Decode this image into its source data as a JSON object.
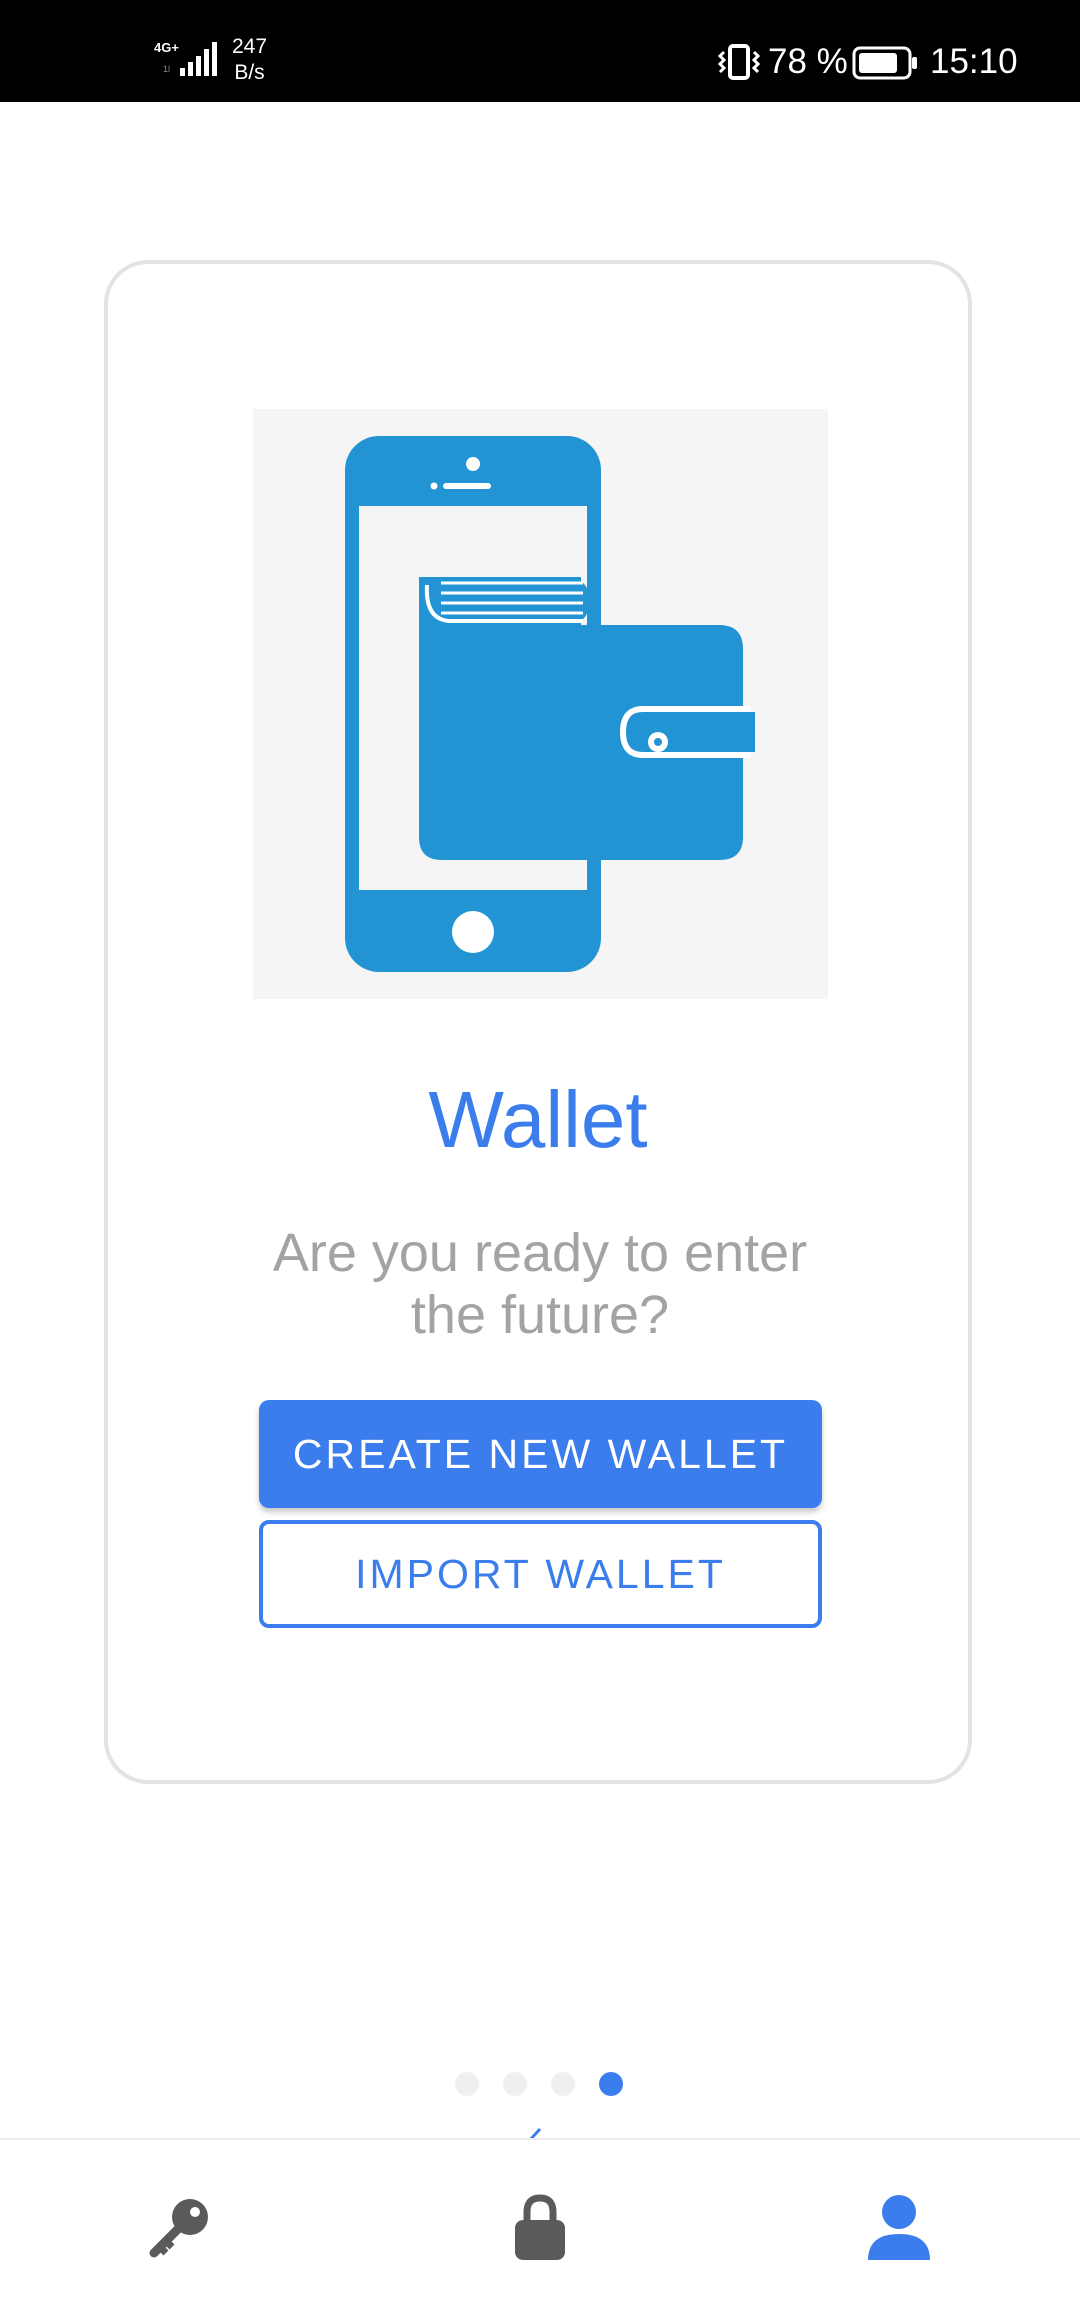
{
  "status_bar": {
    "network": "4G+",
    "speed_value": "247",
    "speed_unit": "B/s",
    "battery_percent": "78 %",
    "time": "15:10",
    "icons": [
      "signal-icon",
      "vibrate-icon",
      "battery-icon"
    ]
  },
  "card": {
    "illustration": "phone-wallet-icon",
    "title": "Wallet",
    "subtitle": "Are you ready to enter the future?",
    "create_button_label": "CREATE NEW WALLET",
    "import_button_label": "IMPORT WALLET"
  },
  "pager": {
    "total": 4,
    "active_index": 3
  },
  "bottom_nav": {
    "items": [
      {
        "icon": "key-icon",
        "active": false
      },
      {
        "icon": "lock-icon",
        "active": false
      },
      {
        "icon": "user-icon",
        "active": true
      }
    ],
    "active_color": "#3b7ded",
    "inactive_color": "#5a5a5a"
  },
  "colors": {
    "accent": "#3b7ded",
    "illustration_blue": "#2294d4",
    "subtitle_gray": "#a3a3a3"
  }
}
